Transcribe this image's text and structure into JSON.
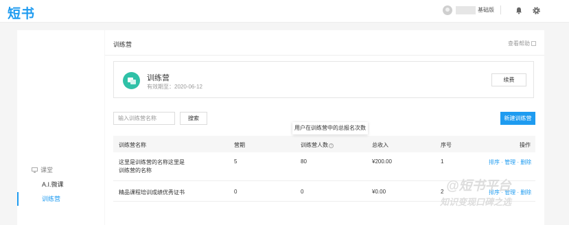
{
  "app": {
    "logo": "短书"
  },
  "header": {
    "plan_tag": "基础版"
  },
  "sidebar": {
    "group_label": "课堂",
    "items": [
      {
        "label": "A.I.微课",
        "active": false
      },
      {
        "label": "训练营",
        "active": true
      }
    ]
  },
  "main": {
    "title": "训练营",
    "help_label": "查看帮助",
    "product": {
      "name": "训练营",
      "expire_label": "有效期至：2020-06-12",
      "renew_label": "续费"
    },
    "search": {
      "placeholder": "输入训练营名称",
      "button_label": "搜索"
    },
    "new_button_label": "新建训练营",
    "tooltip": "用户在训练营中的总报名次数",
    "table": {
      "headers": [
        "训练营名称",
        "营期",
        "训练营人数",
        "总收入",
        "序号",
        "操作"
      ],
      "rows": [
        {
          "name_line1": "这里是训练营的名称这里是",
          "name_line2": "训练营的名称",
          "sessions": "5",
          "members": "80",
          "income": "¥200.00",
          "order": "1"
        },
        {
          "name_line1": "精品课程培训成绩优秀证书",
          "name_line2": "",
          "sessions": "0",
          "members": "0",
          "income": "¥0.00",
          "order": "2"
        }
      ],
      "actions": {
        "sort": "排序",
        "sep": "·",
        "manage": "管理",
        "delete": "删除"
      }
    }
  },
  "watermark": {
    "line1": "@短书平台",
    "line2": "知识变现口碑之选"
  },
  "colors": {
    "accent": "#1e9bf0",
    "product_icon": "#2fc1a7"
  }
}
